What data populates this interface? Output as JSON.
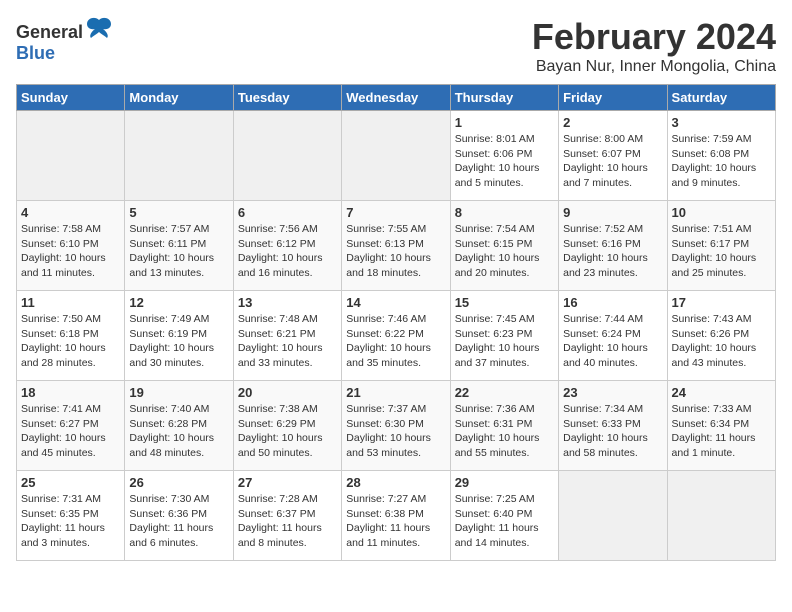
{
  "header": {
    "logo_general": "General",
    "logo_blue": "Blue",
    "month_title": "February 2024",
    "location": "Bayan Nur, Inner Mongolia, China"
  },
  "days_of_week": [
    "Sunday",
    "Monday",
    "Tuesday",
    "Wednesday",
    "Thursday",
    "Friday",
    "Saturday"
  ],
  "weeks": [
    [
      {
        "day": "",
        "info": ""
      },
      {
        "day": "",
        "info": ""
      },
      {
        "day": "",
        "info": ""
      },
      {
        "day": "",
        "info": ""
      },
      {
        "day": "1",
        "info": "Sunrise: 8:01 AM\nSunset: 6:06 PM\nDaylight: 10 hours\nand 5 minutes."
      },
      {
        "day": "2",
        "info": "Sunrise: 8:00 AM\nSunset: 6:07 PM\nDaylight: 10 hours\nand 7 minutes."
      },
      {
        "day": "3",
        "info": "Sunrise: 7:59 AM\nSunset: 6:08 PM\nDaylight: 10 hours\nand 9 minutes."
      }
    ],
    [
      {
        "day": "4",
        "info": "Sunrise: 7:58 AM\nSunset: 6:10 PM\nDaylight: 10 hours\nand 11 minutes."
      },
      {
        "day": "5",
        "info": "Sunrise: 7:57 AM\nSunset: 6:11 PM\nDaylight: 10 hours\nand 13 minutes."
      },
      {
        "day": "6",
        "info": "Sunrise: 7:56 AM\nSunset: 6:12 PM\nDaylight: 10 hours\nand 16 minutes."
      },
      {
        "day": "7",
        "info": "Sunrise: 7:55 AM\nSunset: 6:13 PM\nDaylight: 10 hours\nand 18 minutes."
      },
      {
        "day": "8",
        "info": "Sunrise: 7:54 AM\nSunset: 6:15 PM\nDaylight: 10 hours\nand 20 minutes."
      },
      {
        "day": "9",
        "info": "Sunrise: 7:52 AM\nSunset: 6:16 PM\nDaylight: 10 hours\nand 23 minutes."
      },
      {
        "day": "10",
        "info": "Sunrise: 7:51 AM\nSunset: 6:17 PM\nDaylight: 10 hours\nand 25 minutes."
      }
    ],
    [
      {
        "day": "11",
        "info": "Sunrise: 7:50 AM\nSunset: 6:18 PM\nDaylight: 10 hours\nand 28 minutes."
      },
      {
        "day": "12",
        "info": "Sunrise: 7:49 AM\nSunset: 6:19 PM\nDaylight: 10 hours\nand 30 minutes."
      },
      {
        "day": "13",
        "info": "Sunrise: 7:48 AM\nSunset: 6:21 PM\nDaylight: 10 hours\nand 33 minutes."
      },
      {
        "day": "14",
        "info": "Sunrise: 7:46 AM\nSunset: 6:22 PM\nDaylight: 10 hours\nand 35 minutes."
      },
      {
        "day": "15",
        "info": "Sunrise: 7:45 AM\nSunset: 6:23 PM\nDaylight: 10 hours\nand 37 minutes."
      },
      {
        "day": "16",
        "info": "Sunrise: 7:44 AM\nSunset: 6:24 PM\nDaylight: 10 hours\nand 40 minutes."
      },
      {
        "day": "17",
        "info": "Sunrise: 7:43 AM\nSunset: 6:26 PM\nDaylight: 10 hours\nand 43 minutes."
      }
    ],
    [
      {
        "day": "18",
        "info": "Sunrise: 7:41 AM\nSunset: 6:27 PM\nDaylight: 10 hours\nand 45 minutes."
      },
      {
        "day": "19",
        "info": "Sunrise: 7:40 AM\nSunset: 6:28 PM\nDaylight: 10 hours\nand 48 minutes."
      },
      {
        "day": "20",
        "info": "Sunrise: 7:38 AM\nSunset: 6:29 PM\nDaylight: 10 hours\nand 50 minutes."
      },
      {
        "day": "21",
        "info": "Sunrise: 7:37 AM\nSunset: 6:30 PM\nDaylight: 10 hours\nand 53 minutes."
      },
      {
        "day": "22",
        "info": "Sunrise: 7:36 AM\nSunset: 6:31 PM\nDaylight: 10 hours\nand 55 minutes."
      },
      {
        "day": "23",
        "info": "Sunrise: 7:34 AM\nSunset: 6:33 PM\nDaylight: 10 hours\nand 58 minutes."
      },
      {
        "day": "24",
        "info": "Sunrise: 7:33 AM\nSunset: 6:34 PM\nDaylight: 11 hours\nand 1 minute."
      }
    ],
    [
      {
        "day": "25",
        "info": "Sunrise: 7:31 AM\nSunset: 6:35 PM\nDaylight: 11 hours\nand 3 minutes."
      },
      {
        "day": "26",
        "info": "Sunrise: 7:30 AM\nSunset: 6:36 PM\nDaylight: 11 hours\nand 6 minutes."
      },
      {
        "day": "27",
        "info": "Sunrise: 7:28 AM\nSunset: 6:37 PM\nDaylight: 11 hours\nand 8 minutes."
      },
      {
        "day": "28",
        "info": "Sunrise: 7:27 AM\nSunset: 6:38 PM\nDaylight: 11 hours\nand 11 minutes."
      },
      {
        "day": "29",
        "info": "Sunrise: 7:25 AM\nSunset: 6:40 PM\nDaylight: 11 hours\nand 14 minutes."
      },
      {
        "day": "",
        "info": ""
      },
      {
        "day": "",
        "info": ""
      }
    ]
  ]
}
